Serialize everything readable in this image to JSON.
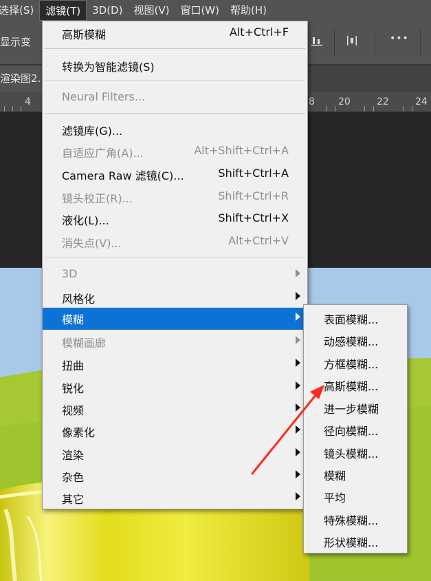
{
  "menubar": {
    "items": [
      "选择(S)",
      "滤镜(T)",
      "3D(D)",
      "视图(V)",
      "窗口(W)",
      "帮助(H)"
    ],
    "active_index": 1
  },
  "optionsbar": {
    "text": "显示变",
    "more_label": "•••"
  },
  "document": {
    "tab_title": "渲染图2."
  },
  "ruler": {
    "labels": [
      "4",
      "8",
      "20",
      "22",
      "24"
    ]
  },
  "filter_menu": {
    "items": [
      {
        "label": "高斯模糊",
        "shortcut": "Alt+Ctrl+F"
      },
      {
        "label": "转换为智能滤镜(S)"
      },
      {
        "label": "Neural Filters...",
        "disabled": true
      },
      {
        "label": "滤镜库(G)..."
      },
      {
        "label": "自适应广角(A)...",
        "shortcut": "Alt+Shift+Ctrl+A",
        "disabled": true
      },
      {
        "label": "Camera Raw 滤镜(C)...",
        "shortcut": "Shift+Ctrl+A"
      },
      {
        "label": "镜头校正(R)...",
        "shortcut": "Shift+Ctrl+R",
        "disabled": true
      },
      {
        "label": "液化(L)...",
        "shortcut": "Shift+Ctrl+X"
      },
      {
        "label": "消失点(V)...",
        "shortcut": "Alt+Ctrl+V",
        "disabled": true
      },
      {
        "label": "3D",
        "submenu": true,
        "disabled": true
      },
      {
        "label": "风格化",
        "submenu": true
      },
      {
        "label": "模糊",
        "submenu": true,
        "highlighted": true
      },
      {
        "label": "模糊画廊",
        "submenu": true,
        "disabled": true
      },
      {
        "label": "扭曲",
        "submenu": true
      },
      {
        "label": "锐化",
        "submenu": true
      },
      {
        "label": "视频",
        "submenu": true
      },
      {
        "label": "像素化",
        "submenu": true
      },
      {
        "label": "渲染",
        "submenu": true
      },
      {
        "label": "杂色",
        "submenu": true
      },
      {
        "label": "其它",
        "submenu": true
      }
    ]
  },
  "blur_submenu": {
    "items": [
      "表面模糊...",
      "动感模糊...",
      "方框模糊...",
      "高斯模糊...",
      "进一步模糊",
      "径向模糊...",
      "镜头模糊...",
      "模糊",
      "平均",
      "特殊模糊...",
      "形状模糊..."
    ]
  },
  "colors": {
    "highlight": "#0c72d6",
    "annotation_arrow": "#ff2a1a",
    "menubar_bg": "#535353"
  }
}
